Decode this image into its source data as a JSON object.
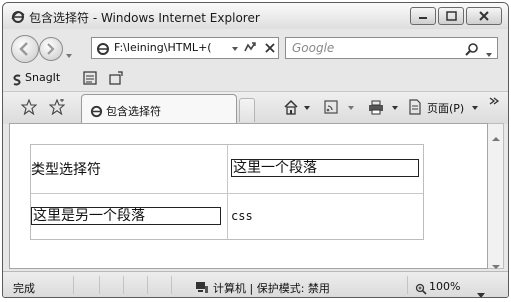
{
  "window": {
    "title": "包含选择符 - Windows Internet Explorer"
  },
  "address_bar": {
    "url": "F:\\leining\\HTML+(",
    "search_placeholder": "Google"
  },
  "toolbar": {
    "snagit_label": "SnagIt"
  },
  "tabs": [
    {
      "label": "包含选择符"
    }
  ],
  "command_bar": {
    "page_menu_label": "页面(P)"
  },
  "page": {
    "cells": {
      "r1c1": "类型选择符",
      "r1c2": "这里一个段落",
      "r2c1": "这里是另一个段落",
      "r2c2": "css"
    }
  },
  "status_bar": {
    "status": "完成",
    "zone": "计算机 | 保护模式: 禁用",
    "zoom": "100%"
  },
  "colors": {
    "window_border": "#5b5b5b",
    "chrome_bg": "#e7e7e7",
    "paragraph_border": "#222222"
  }
}
